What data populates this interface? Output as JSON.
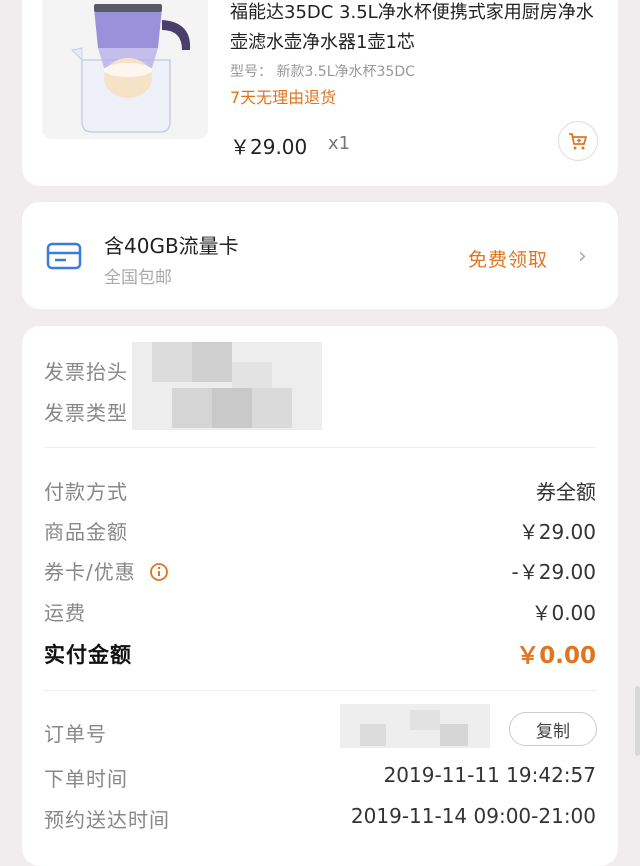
{
  "product": {
    "title": "福能达35DC 3.5L净水杯便携式家用厨房净水壶滤水壶净水器1壶1芯",
    "model": "型号： 新款3.5L净水杯35DC",
    "return_policy": "7天无理由退货",
    "price": "￥29.00",
    "qty": "x1"
  },
  "flow_card": {
    "title": "含40GB流量卡",
    "subtitle": "全国包邮",
    "cta": "免费领取"
  },
  "invoice": {
    "title_label": "发票抬头",
    "type_label": "发票类型"
  },
  "payment": {
    "method_label": "付款方式",
    "method_value": "券全额",
    "goods_label": "商品金额",
    "goods_value": "￥29.00",
    "discount_label": "券卡/优惠",
    "discount_value": "-￥29.00",
    "shipping_label": "运费",
    "shipping_value": "￥0.00",
    "paid_label": "实付金额",
    "paid_value": "￥0.00"
  },
  "order": {
    "id_label": "订单号",
    "copy_label": "复制",
    "time_label": "下单时间",
    "time_value": "2019-11-11 19:42:57",
    "delivery_label": "预约送达时间",
    "delivery_value": "2019-11-14 09:00-21:00"
  },
  "colors": {
    "accent": "#e07521",
    "card_icon": "#3a7be0",
    "background": "#f1ecee"
  }
}
